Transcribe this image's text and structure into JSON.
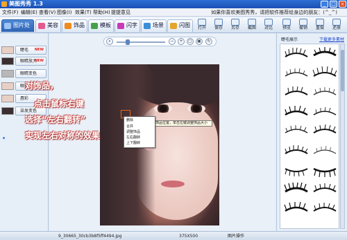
{
  "window": {
    "title": "美图秀秀 1.3",
    "controls": [
      "_",
      "□",
      "×"
    ]
  },
  "menu": {
    "items": [
      "文件(F)",
      "编辑(E)",
      "查看(V)",
      "图像(I)",
      "效果(T)",
      "帮助(H)",
      "提提意见"
    ],
    "promo": "如果你喜欢美图秀秀，请把软件推荐给身边的朋友：(^_^)"
  },
  "tabs": [
    {
      "label": "图片处理",
      "color": "#2f63b4",
      "active": true
    },
    {
      "label": "美容",
      "color": "#e45a8e",
      "active": false
    },
    {
      "label": "饰品",
      "color": "#f08a1c",
      "active": false
    },
    {
      "label": "模板",
      "color": "#47a14a",
      "active": false
    },
    {
      "label": "闪字",
      "color": "#c83ab7",
      "active": false
    },
    {
      "label": "场景",
      "color": "#3a8fd8",
      "active": false
    },
    {
      "label": "闪图",
      "color": "#e4a52a",
      "active": false
    }
  ],
  "toolbar": {
    "buttons": [
      "打开",
      "保存",
      "另存",
      "截图",
      "对比",
      "预览",
      "撤销",
      "重做",
      "还原"
    ]
  },
  "left_panel": {
    "items": [
      {
        "label": "睫毛",
        "new": "NEW"
      },
      {
        "label": "眼睛放大",
        "new": "NEW"
      },
      {
        "label": "眼睛变色",
        "new": ""
      },
      {
        "label": "眼影",
        "new": ""
      },
      {
        "label": "唇彩",
        "new": ""
      },
      {
        "label": "染发变色",
        "new": ""
      }
    ]
  },
  "zoom": {
    "icons": [
      "search-icon",
      "zoom-out-icon",
      "zoom-in-icon",
      "fit-icon",
      "original-icon",
      "rotate-icon"
    ]
  },
  "context_menu": {
    "items": [
      "删除",
      "合并",
      "调整饰品",
      "左右翻转",
      "上下翻转"
    ]
  },
  "hint_text": "拖动饰品可以改变饰品位置，单击左键调整饰品大小",
  "right_panel": {
    "title": "睫毛展示",
    "link": "下载更多素材"
  },
  "status": {
    "filename": "9_30665_30cb3b8f5ff4494.jpg",
    "dimensions": "375X500",
    "action": "图片操作"
  },
  "overlay": {
    "line1": "对饰品，",
    "line2": "点击鼠标右键",
    "line3": "选择“左右翻转”",
    "line4": "实现左右对称的效果"
  }
}
